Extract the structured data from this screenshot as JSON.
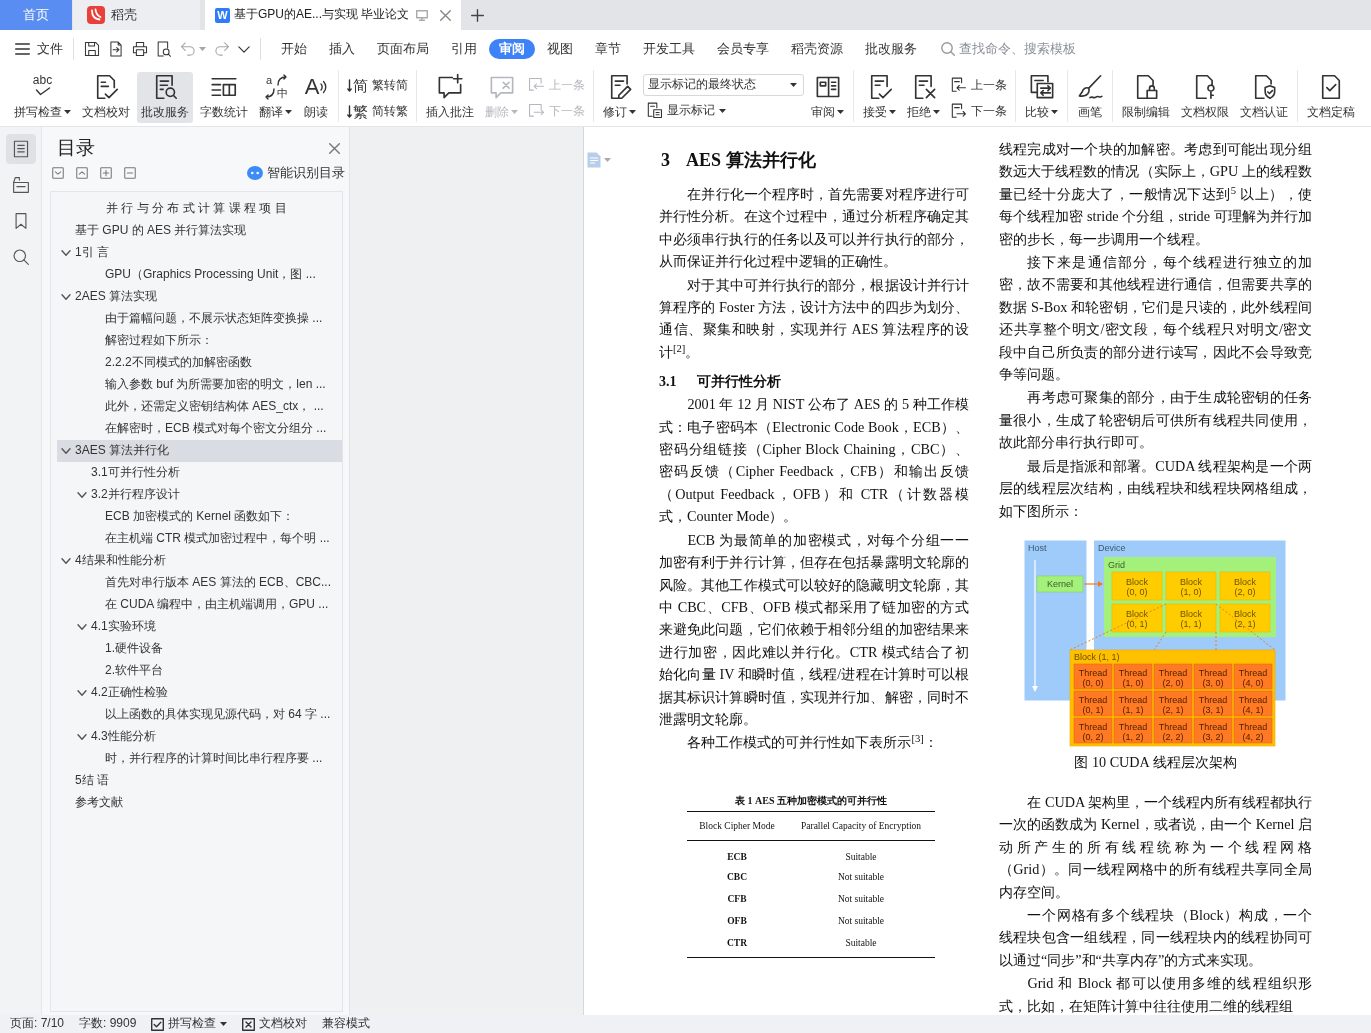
{
  "tabs": [
    {
      "kind": "home",
      "label": "首页",
      "selected": false
    },
    {
      "kind": "docer",
      "label": "稻壳",
      "selected": false
    },
    {
      "kind": "document",
      "glyph": "W",
      "label": "基于GPU的AE...与实现 毕业论文",
      "selected": true
    }
  ],
  "menu": {
    "file": "文件",
    "quick_access": [
      {
        "kind": "save",
        "disabled": false
      },
      {
        "kind": "export",
        "disabled": false
      },
      {
        "kind": "print",
        "disabled": false
      },
      {
        "kind": "preview",
        "disabled": false
      },
      {
        "kind": "undo",
        "disabled": true
      },
      {
        "kind": "redo",
        "disabled": true
      },
      {
        "kind": "more",
        "disabled": false
      }
    ],
    "tabs": [
      {
        "label": "开始",
        "selected": false
      },
      {
        "label": "插入",
        "selected": false
      },
      {
        "label": "页面布局",
        "selected": false
      },
      {
        "label": "引用",
        "selected": false
      },
      {
        "label": "审阅",
        "selected": true
      },
      {
        "label": "视图",
        "selected": false
      },
      {
        "label": "章节",
        "selected": false
      },
      {
        "label": "开发工具",
        "selected": false
      },
      {
        "label": "会员专享",
        "selected": false
      },
      {
        "label": "稻壳资源",
        "selected": false
      },
      {
        "label": "批改服务",
        "selected": false
      }
    ],
    "search": {
      "placeholder": "查找命令、搜索模板"
    }
  },
  "ribbon": {
    "groups": [
      {
        "items": [
          {
            "kind": "large",
            "glyph": "abc",
            "label": "拼写检查",
            "dropdown": true,
            "disabled": false,
            "active": false
          },
          {
            "kind": "large",
            "label": "文档校对",
            "dropdown": false,
            "disabled": false,
            "active": false
          },
          {
            "kind": "large",
            "label": "批改服务",
            "dropdown": false,
            "disabled": false,
            "active": true
          },
          {
            "kind": "large",
            "label": "字数统计",
            "dropdown": false,
            "disabled": false,
            "active": false
          },
          {
            "kind": "large",
            "glyphs": [
              "a",
              "中"
            ],
            "label": "翻译",
            "dropdown": true,
            "disabled": false,
            "active": false
          },
          {
            "kind": "large",
            "glyph": "A",
            "label": "朗读",
            "dropdown": false,
            "disabled": false,
            "active": false
          }
        ]
      },
      {
        "items": [
          {
            "kind": "small",
            "glyph": "简",
            "label": "繁转简",
            "dropdown": false,
            "disabled": false,
            "active": false
          },
          {
            "kind": "small",
            "glyph": "繁",
            "label": "简转繁",
            "dropdown": false,
            "disabled": false,
            "active": false
          }
        ]
      },
      {
        "items": [
          {
            "kind": "large",
            "label": "插入批注",
            "dropdown": false,
            "disabled": false,
            "active": false
          },
          {
            "kind": "large",
            "label": "删除",
            "dropdown": true,
            "disabled": true,
            "active": false
          },
          {
            "kind": "small",
            "label": "上一条",
            "dropdown": false,
            "disabled": true,
            "active": false
          },
          {
            "kind": "small",
            "label": "下一条",
            "dropdown": false,
            "disabled": true,
            "active": false
          }
        ]
      },
      {
        "items": [
          {
            "kind": "large",
            "label": "修订",
            "dropdown": true,
            "disabled": false,
            "active": false
          },
          {
            "kind": "select",
            "value": "显示标记的最终状态"
          },
          {
            "kind": "small",
            "label": "显示标记",
            "dropdown": true,
            "disabled": false,
            "active": false
          },
          {
            "kind": "large",
            "label": "审阅",
            "dropdown": true,
            "disabled": false,
            "active": false
          }
        ]
      },
      {
        "items": [
          {
            "kind": "large",
            "label": "接受",
            "dropdown": true,
            "disabled": false,
            "active": false
          },
          {
            "kind": "large",
            "label": "拒绝",
            "dropdown": true,
            "disabled": false,
            "active": false
          },
          {
            "kind": "small",
            "label": "上一条",
            "dropdown": false,
            "disabled": false,
            "active": false
          },
          {
            "kind": "small",
            "label": "下一条",
            "dropdown": false,
            "disabled": false,
            "active": false
          }
        ]
      },
      {
        "items": [
          {
            "kind": "large",
            "label": "比较",
            "dropdown": true,
            "disabled": false,
            "active": false
          }
        ]
      },
      {
        "items": [
          {
            "kind": "large",
            "label": "画笔",
            "dropdown": false,
            "disabled": false,
            "active": false
          }
        ]
      },
      {
        "items": [
          {
            "kind": "large",
            "label": "限制编辑",
            "dropdown": false,
            "disabled": false,
            "active": false
          },
          {
            "kind": "large",
            "label": "文档权限",
            "dropdown": false,
            "disabled": false,
            "active": false
          },
          {
            "kind": "large",
            "label": "文档认证",
            "dropdown": false,
            "disabled": false,
            "active": false
          }
        ]
      },
      {
        "items": [
          {
            "kind": "large",
            "label": "文档定稿",
            "dropdown": false,
            "disabled": false,
            "active": false
          }
        ]
      }
    ]
  },
  "sidebar": {
    "side_tabs": [
      {
        "kind": "toc",
        "selected": true
      },
      {
        "kind": "outline",
        "selected": false
      },
      {
        "kind": "bookmark",
        "selected": false
      },
      {
        "kind": "search",
        "selected": false
      }
    ],
    "title": "目录",
    "smart_toc": "智能识别目录",
    "toc": [
      {
        "kind": "title",
        "label": "并 行 与 分 布 式 计 算 课 程 项 目",
        "selected": false
      },
      {
        "kind": "heading",
        "label": "基于 GPU 的 AES 并行算法实现",
        "selected": false
      },
      {
        "kind": "heading",
        "label": "1引 言",
        "selected": false,
        "expanded": true,
        "children": [
          {
            "kind": "text",
            "label": "GPU（Graphics Processing Unit，图 ...",
            "selected": false
          }
        ]
      },
      {
        "kind": "heading",
        "label": "2AES 算法实现",
        "selected": false,
        "expanded": true,
        "children": [
          {
            "kind": "text",
            "label": "由于篇幅问题，不展示状态矩阵变换操 ...",
            "selected": false
          },
          {
            "kind": "text",
            "label": "解密过程如下所示：",
            "selected": false
          },
          {
            "kind": "text",
            "label": "2.2.2不同模式的加解密函数",
            "selected": false
          },
          {
            "kind": "text",
            "label": "输入参数 buf 为所需要加密的明文，len ...",
            "selected": false
          },
          {
            "kind": "text",
            "label": "此外，还需定义密钥结构体 AES_ctx， ...",
            "selected": false
          },
          {
            "kind": "text",
            "label": "在解密时，ECB 模式对每个密文分组分 ...",
            "selected": false
          }
        ]
      },
      {
        "kind": "heading",
        "label": "3AES 算法并行化",
        "selected": true,
        "expanded": true,
        "children": [
          {
            "kind": "heading",
            "label": "3.1可并行性分析",
            "selected": false
          },
          {
            "kind": "heading",
            "label": "3.2并行程序设计",
            "selected": false,
            "expanded": true,
            "children": [
              {
                "label": "ECB 加密模式的 Kernel 函数如下：",
                "selected": false
              },
              {
                "label": "在主机端 CTR 模式加密过程中，每个明 ...",
                "selected": false
              }
            ]
          }
        ]
      },
      {
        "kind": "heading",
        "label": "4结果和性能分析",
        "selected": false,
        "expanded": true,
        "children": [
          {
            "kind": "text",
            "label": "首先对串行版本 AES 算法的 ECB、CBC...",
            "selected": false
          },
          {
            "kind": "text",
            "label": "在 CUDA 编程中，由主机端调用，GPU ...",
            "selected": false
          },
          {
            "kind": "heading",
            "label": "4.1实验环境",
            "selected": false,
            "expanded": true,
            "children": [
              {
                "label": "1.硬件设备",
                "selected": false
              },
              {
                "label": "2.软件平台",
                "selected": false
              }
            ]
          },
          {
            "kind": "heading",
            "label": "4.2正确性检验",
            "selected": false,
            "expanded": true,
            "children": [
              {
                "label": "以上函数的具体实现见源代码，对 64 字 ...",
                "selected": false
              }
            ]
          },
          {
            "kind": "heading",
            "label": "4.3性能分析",
            "selected": false,
            "expanded": true,
            "children": [
              {
                "label": "时，并行程序的计算时间比串行程序要 ...",
                "selected": false
              }
            ]
          }
        ]
      },
      {
        "kind": "heading",
        "label": "5结 语",
        "selected": false
      },
      {
        "kind": "heading",
        "label": "参考文献",
        "selected": false
      }
    ]
  },
  "document": {
    "columns": [
      [
        {
          "kind": "heading",
          "number": "3",
          "title": "AES 算法并行化"
        },
        {
          "kind": "paragraph",
          "text": "在并行化一个程序时，首先需要对程序进行可并行性分析。在这个过程中，通过分析程序确定其中必须串行执行的任务以及可以并行执行的部分，从而保证并行化过程中逻辑的正确性。"
        },
        {
          "kind": "paragraph",
          "text": "对于其中可并行执行的部分，根据设计并行计算程序的 Foster 方法，设计方法中的四步为划分、通信、聚集和映射，实现并行 AES 算法程序的设计$^{[2]}$。"
        },
        {
          "kind": "subheading",
          "number": "3.1",
          "title": "可并行性分析"
        },
        {
          "kind": "paragraph",
          "text": "2001 年 12 月 NIST 公布了 AES 的 5 种工作模式：电子密码本（Electronic Code Book，ECB）、密码分组链接（Cipher Block Chaining，CBC）、密码反馈（Cipher Feedback，CFB）和输出反馈（Output Feedback，OFB）和 CTR（计数器模式，Counter Mode）。"
        },
        {
          "kind": "paragraph",
          "text": "ECB 为最简单的加密模式，对每个分组一一加密有利于并行计算，但存在包括暴露明文轮廓的风险。其他工作模式可以较好的隐藏明文轮廓，其中 CBC、CFB、OFB 模式都采用了链加密的方式来避免此问题，它们依赖于相邻分组的加密结果来进行加密，因此难以并行化。CTR 模式结合了初始化向量 IV 和瞬时值，线程/进程在计算时可以根据其标识计算瞬时值，实现并行加、解密，同时不泄露明文轮廓。"
        },
        {
          "kind": "paragraph",
          "text": "各种工作模式的可并行性如下表所示$^{[3]}$："
        },
        {
          "kind": "table",
          "caption": "表 1 AES 五种加密模式的可并行性",
          "columns": [
            "Block Cipher Mode",
            "Parallel Capacity of Encryption"
          ],
          "rows": [
            [
              "ECB",
              "Suitable"
            ],
            [
              "CBC",
              "Not suitable"
            ],
            [
              "CFB",
              "Not suitable"
            ],
            [
              "OFB",
              "Not suitable"
            ],
            [
              "CTR",
              "Suitable"
            ]
          ]
        }
      ],
      [
        {
          "kind": "continuation",
          "text": "线程完成对一个块的加解密。考虑到可能出现分组数远大于线程数的情况（实际上，GPU 上的线程数量已经十分庞大了，一般情况下达到$^{5}$ 以上），使每个线程加密 stride 个分组，stride 可理解为并行加密的步长，每一步调用一个线程。"
        },
        {
          "kind": "paragraph",
          "text": "接下来是通信部分，每个线程进行独立的加密，故不需要和其他线程进行通信，但需要共享的数据 S-Box 和轮密钥，它们是只读的，此外线程间还共享整个明文/密文段，每个线程只对明文/密文段中自己所负责的部分进行读写，因此不会导致竞争等问题。"
        },
        {
          "kind": "paragraph",
          "text": "再考虑可聚集的部分，由于生成轮密钥的任务量很小，生成了轮密钥后可供所有线程共同使用，故此部分串行执行即可。"
        },
        {
          "kind": "paragraph",
          "text": "最后是指派和部署。CUDA 线程架构是一个两层的线程层次结构，由线程块和线程块网格组成，如下图所示："
        },
        {
          "kind": "figure",
          "host": "Host",
          "device": "Device",
          "grid": "Grid",
          "kernel": "Kernel",
          "blocks": [
            {
              "label": "Block",
              "coords": "(0, 0)"
            },
            {
              "label": "Block",
              "coords": "(1, 0)"
            },
            {
              "label": "Block",
              "coords": "(2, 0)"
            },
            {
              "label": "Block",
              "coords": "(0, 1)"
            },
            {
              "label": "Block",
              "coords": "(1, 1)"
            },
            {
              "label": "Block",
              "coords": "(2, 1)"
            }
          ],
          "detail": "Block (1, 1)",
          "threads": [
            {
              "label": "Thread",
              "coords": "(0, 0)"
            },
            {
              "label": "Thread",
              "coords": "(1, 0)"
            },
            {
              "label": "Thread",
              "coords": "(2, 0)"
            },
            {
              "label": "Thread",
              "coords": "(3, 0)"
            },
            {
              "label": "Thread",
              "coords": "(4, 0)"
            },
            {
              "label": "Thread",
              "coords": "(0, 1)"
            },
            {
              "label": "Thread",
              "coords": "(1, 1)"
            },
            {
              "label": "Thread",
              "coords": "(2, 1)"
            },
            {
              "label": "Thread",
              "coords": "(3, 1)"
            },
            {
              "label": "Thread",
              "coords": "(4, 1)"
            },
            {
              "label": "Thread",
              "coords": "(0, 2)"
            },
            {
              "label": "Thread",
              "coords": "(1, 2)"
            },
            {
              "label": "Thread",
              "coords": "(2, 2)"
            },
            {
              "label": "Thread",
              "coords": "(3, 2)"
            },
            {
              "label": "Thread",
              "coords": "(4, 2)"
            }
          ]
        },
        {
          "kind": "caption",
          "text": "图 10 CUDA 线程层次架构"
        },
        {
          "kind": "paragraph",
          "text": "在 CUDA 架构里，一个线程内所有线程都执行一次的函数成为 Kernel，或者说，由一个 Kernel 启动所产生的所有线程统称为一个线程网格（Grid）。同一线程网格中的所有线程共享同全局内存空间。"
        },
        {
          "kind": "paragraph",
          "text": "一个网格有多个线程块（Block）构成，一个线程块包含一组线程，同一线程块内的线程协同可以通过“同步”和“共享内存”的方式来实现。"
        },
        {
          "kind": "paragraph",
          "text": "Grid 和 Block 都可以使用多维的线程组织形式，比如，在矩阵计算中往往使用二维的线程组"
        }
      ]
    ]
  },
  "status_bar": {
    "items": [
      {
        "kind": "text",
        "label": "页面: 7/10"
      },
      {
        "kind": "text",
        "label": "字数: 9909"
      },
      {
        "kind": "spellcheck",
        "label": "拼写检查",
        "dropdown": true
      },
      {
        "kind": "proofread",
        "label": "文档校对",
        "dropdown": false
      },
      {
        "kind": "text",
        "label": "兼容模式"
      }
    ]
  }
}
